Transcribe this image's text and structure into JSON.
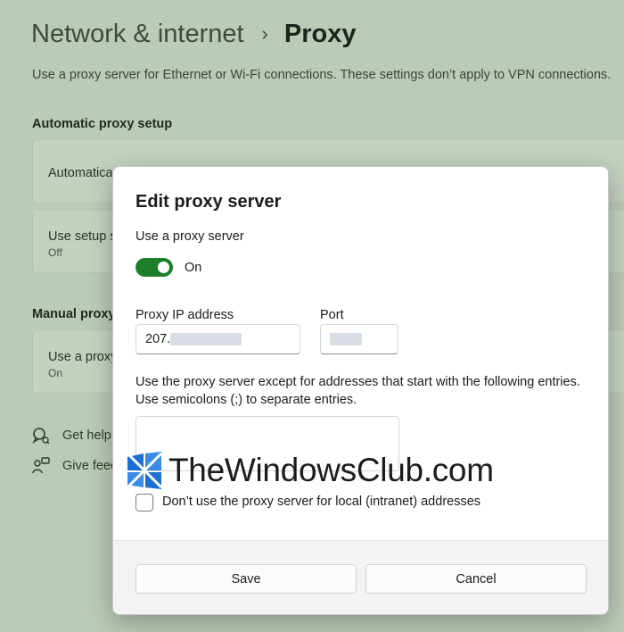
{
  "page": {
    "breadcrumb_parent": "Network & internet",
    "breadcrumb_separator": "›",
    "breadcrumb_current": "Proxy",
    "description": "Use a proxy server for Ethernet or Wi-Fi connections. These settings don’t apply to VPN connections.",
    "auto_section_title": "Automatic proxy setup",
    "auto_detect_label": "Automatica",
    "setup_script_label": "Use setup s",
    "setup_script_state": "Off",
    "manual_section_title": "Manual proxy",
    "manual_proxy_label": "Use a proxy",
    "manual_proxy_state": "On",
    "get_help": "Get help",
    "give_feedback": "Give feed"
  },
  "dialog": {
    "title": "Edit proxy server",
    "use_proxy_label": "Use a proxy server",
    "toggle_state": "On",
    "ip_label": "Proxy IP address",
    "ip_value": "207.",
    "port_label": "Port",
    "port_value": "",
    "exceptions_line1": "Use the proxy server except for addresses that start with the following entries.",
    "exceptions_line2": "Use semicolons (;) to separate entries.",
    "exceptions_value": "",
    "local_checkbox_label": "Don’t use the proxy server for local (intranet) addresses",
    "save_label": "Save",
    "cancel_label": "Cancel"
  },
  "watermark": {
    "text": "TheWindowsClub.com"
  },
  "colors": {
    "accent": "#1e7f2b",
    "logo_blue": "#1e6fd1"
  }
}
